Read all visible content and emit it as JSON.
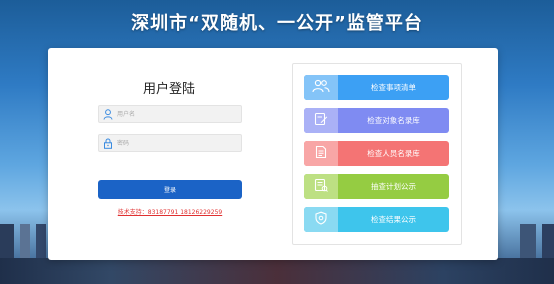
{
  "header": {
    "title": "深圳市“双随机、一公开”监管平台"
  },
  "login": {
    "heading": "用户登陆",
    "username_placeholder": "用户名",
    "password_placeholder": "密码",
    "submit_label": "登录",
    "support_text": "技术支持：83187791 18126229259"
  },
  "quick_links": [
    {
      "label": "检查事项清单",
      "icon": "people-icon",
      "color": "#3ca0f4",
      "icon_bg": "#84c4f8"
    },
    {
      "label": "检查对象名录库",
      "icon": "edit-document-icon",
      "color": "#7f8bf2",
      "icon_bg": "#aab1f6"
    },
    {
      "label": "检查人员名录库",
      "icon": "document-list-icon",
      "color": "#f47474",
      "icon_bg": "#f8a6a6"
    },
    {
      "label": "抽查计划公示",
      "icon": "plan-icon",
      "color": "#95cc42",
      "icon_bg": "#bde083"
    },
    {
      "label": "检查结果公示",
      "icon": "shield-icon",
      "color": "#3ec5ec",
      "icon_bg": "#8adaf2"
    }
  ]
}
